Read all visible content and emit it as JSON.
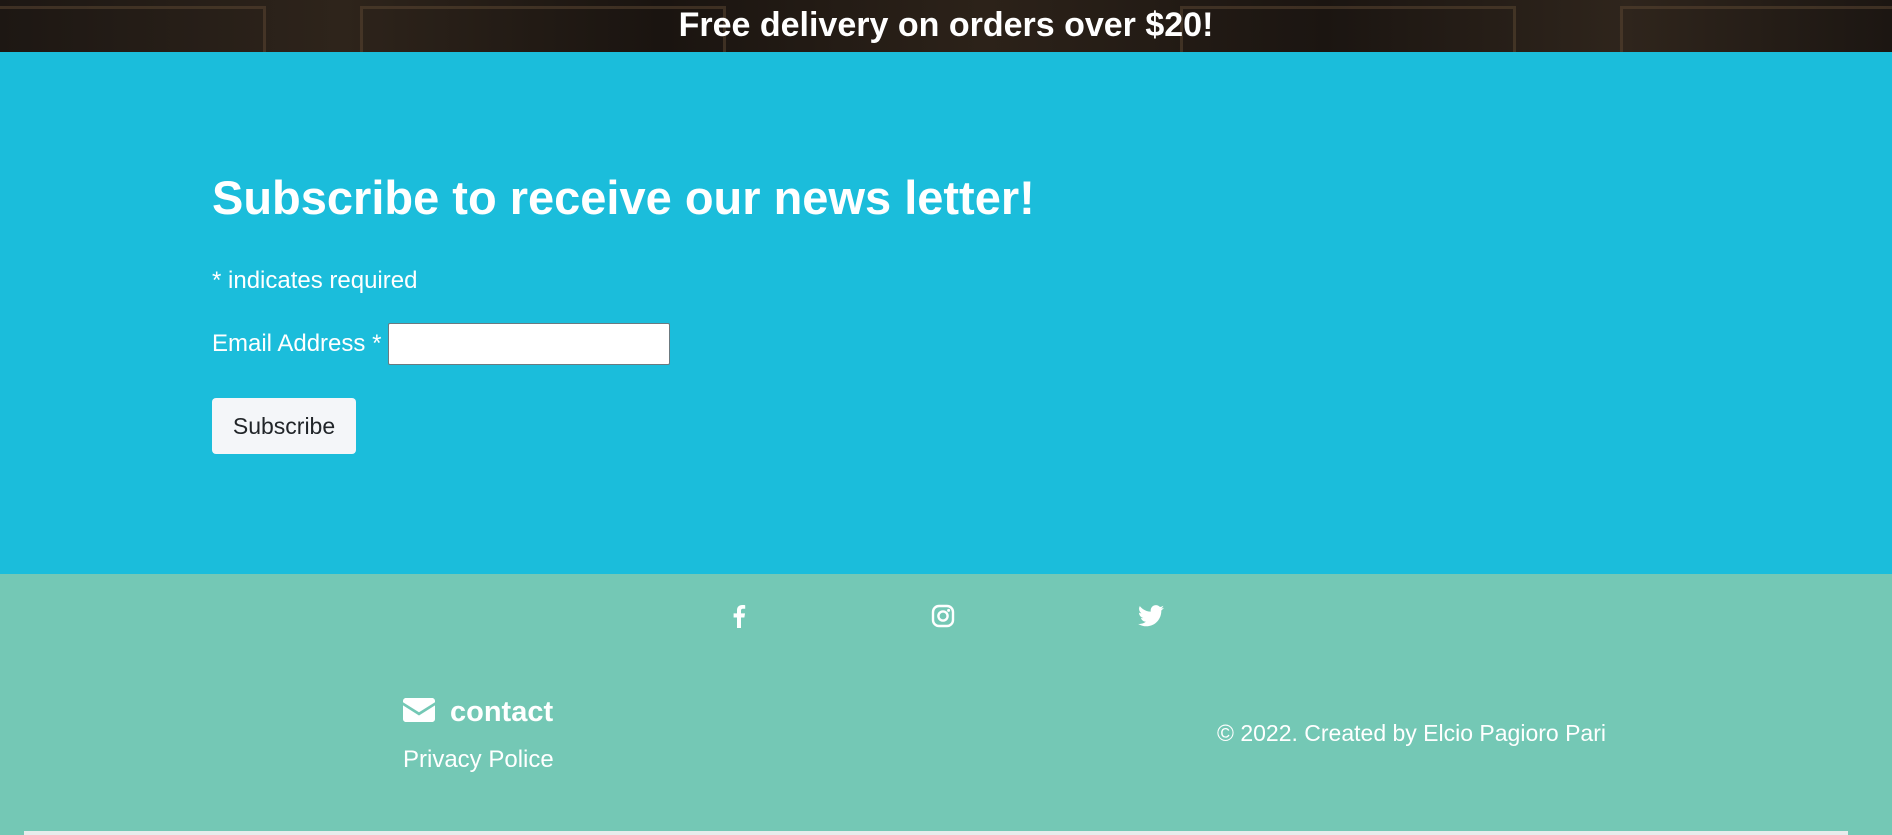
{
  "banner": {
    "text": "Free delivery on orders over $20!"
  },
  "newsletter": {
    "title": "Subscribe to receive our news letter!",
    "required_note": "* indicates required",
    "email_label": "Email Address *",
    "email_value": "",
    "subscribe_label": "Subscribe",
    "background_color": "#1bbddb"
  },
  "footer": {
    "social_icons": [
      "facebook-icon",
      "instagram-icon",
      "twitter-icon"
    ],
    "contact_icon": "envelope-icon",
    "contact_label": "contact",
    "privacy_label": "Privacy Police",
    "copyright": "© 2022. Created by Elcio Pagioro Pari",
    "background_color": "#74c8b5"
  }
}
